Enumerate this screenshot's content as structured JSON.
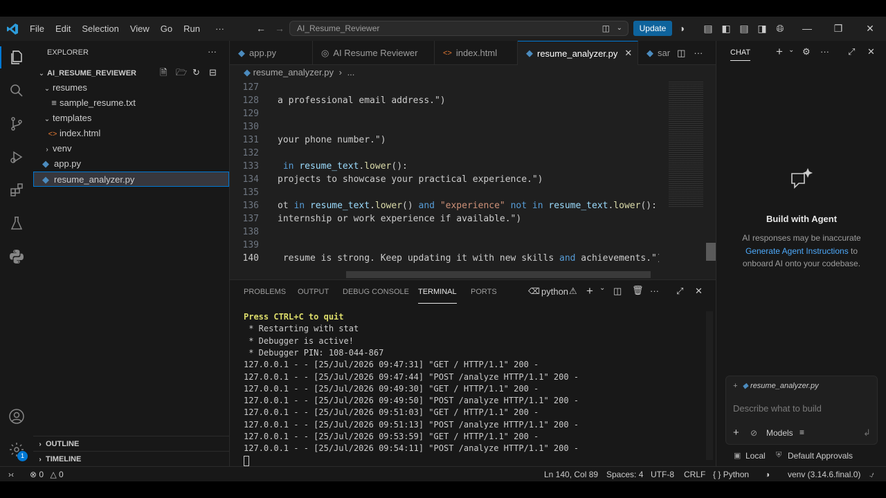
{
  "titlebar": {
    "menu": [
      "File",
      "Edit",
      "Selection",
      "View",
      "Go",
      "Run",
      "···"
    ],
    "search_text": "AI_Resume_Reviewer",
    "update_label": "Update"
  },
  "sidebar": {
    "title": "EXPLORER",
    "root": "AI_RESUME_REVIEWER",
    "items": [
      {
        "label": "resumes",
        "type": "folder"
      },
      {
        "label": "sample_resume.txt",
        "type": "file"
      },
      {
        "label": "templates",
        "type": "folder"
      },
      {
        "label": "index.html",
        "type": "file"
      },
      {
        "label": "venv",
        "type": "folder"
      },
      {
        "label": "app.py",
        "type": "file"
      },
      {
        "label": "resume_analyzer.py",
        "type": "file"
      }
    ],
    "outline": "OUTLINE",
    "timeline": "TIMELINE",
    "accounts_badge": "1"
  },
  "editor": {
    "tabs": [
      "app.py",
      "AI Resume Reviewer",
      "index.html",
      "resume_analyzer.py",
      "sar"
    ],
    "breadcrumb_file": "resume_analyzer.py",
    "breadcrumb_more": "...",
    "lines": [
      {
        "n": "127",
        "t": ""
      },
      {
        "n": "128",
        "t": "a professional email address.\")"
      },
      {
        "n": "129",
        "t": ""
      },
      {
        "n": "130",
        "t": ""
      },
      {
        "n": "131",
        "t": "your phone number.\")"
      },
      {
        "n": "132",
        "t": ""
      },
      {
        "n": "133",
        "t": " in resume_text.lower():"
      },
      {
        "n": "134",
        "t": "projects to showcase your practical experience.\")"
      },
      {
        "n": "135",
        "t": ""
      },
      {
        "n": "136",
        "t": "ot in resume_text.lower() and \"experience\" not in resume_text.lower():"
      },
      {
        "n": "137",
        "t": "internship or work experience if available.\")"
      },
      {
        "n": "138",
        "t": ""
      },
      {
        "n": "139",
        "t": ""
      },
      {
        "n": "140",
        "t": " resume is strong. Keep updating it with new skills and achievements.\")"
      }
    ]
  },
  "panel": {
    "tabs": [
      "PROBLEMS",
      "OUTPUT",
      "DEBUG CONSOLE",
      "TERMINAL",
      "PORTS"
    ],
    "active_tab": "TERMINAL",
    "terminal_name": "python",
    "terminal_lines": [
      "Press CTRL+C to quit",
      " * Restarting with stat",
      " * Debugger is active!",
      " * Debugger PIN: 108-044-867",
      "127.0.0.1 - - [25/Jul/2026 09:47:31] \"GET / HTTP/1.1\" 200 -",
      "127.0.0.1 - - [25/Jul/2026 09:47:44] \"POST /analyze HTTP/1.1\" 200 -",
      "127.0.0.1 - - [25/Jul/2026 09:49:30] \"GET / HTTP/1.1\" 200 -",
      "127.0.0.1 - - [25/Jul/2026 09:49:50] \"POST /analyze HTTP/1.1\" 200 -",
      "127.0.0.1 - - [25/Jul/2026 09:51:03] \"GET / HTTP/1.1\" 200 -",
      "127.0.0.1 - - [25/Jul/2026 09:51:13] \"POST /analyze HTTP/1.1\" 200 -",
      "127.0.0.1 - - [25/Jul/2026 09:53:59] \"GET / HTTP/1.1\" 200 -",
      "127.0.0.1 - - [25/Jul/2026 09:54:11] \"POST /analyze HTTP/1.1\" 200 -"
    ]
  },
  "chat": {
    "title": "CHAT",
    "heading": "Build with Agent",
    "desc_before": "AI responses may be inaccurate",
    "link": "Generate Agent Instructions",
    "desc_after_1": "to",
    "desc_after_2": "onboard AI onto your codebase.",
    "context_file": "resume_analyzer.py",
    "input_placeholder": "Describe what to build",
    "models_label": "Models",
    "local_label": "Local",
    "approvals_label": "Default Approvals"
  },
  "status": {
    "errors": "0",
    "warnings": "0",
    "position": "Ln 140, Col 89",
    "spaces": "Spaces: 4",
    "encoding": "UTF-8",
    "eol": "CRLF",
    "language": "Python",
    "env": "venv (3.14.6.final.0)"
  },
  "colors": {
    "accent": "#0078d4",
    "update_button": "#0e639c",
    "terminal_highlight": "#dcdc6a"
  }
}
